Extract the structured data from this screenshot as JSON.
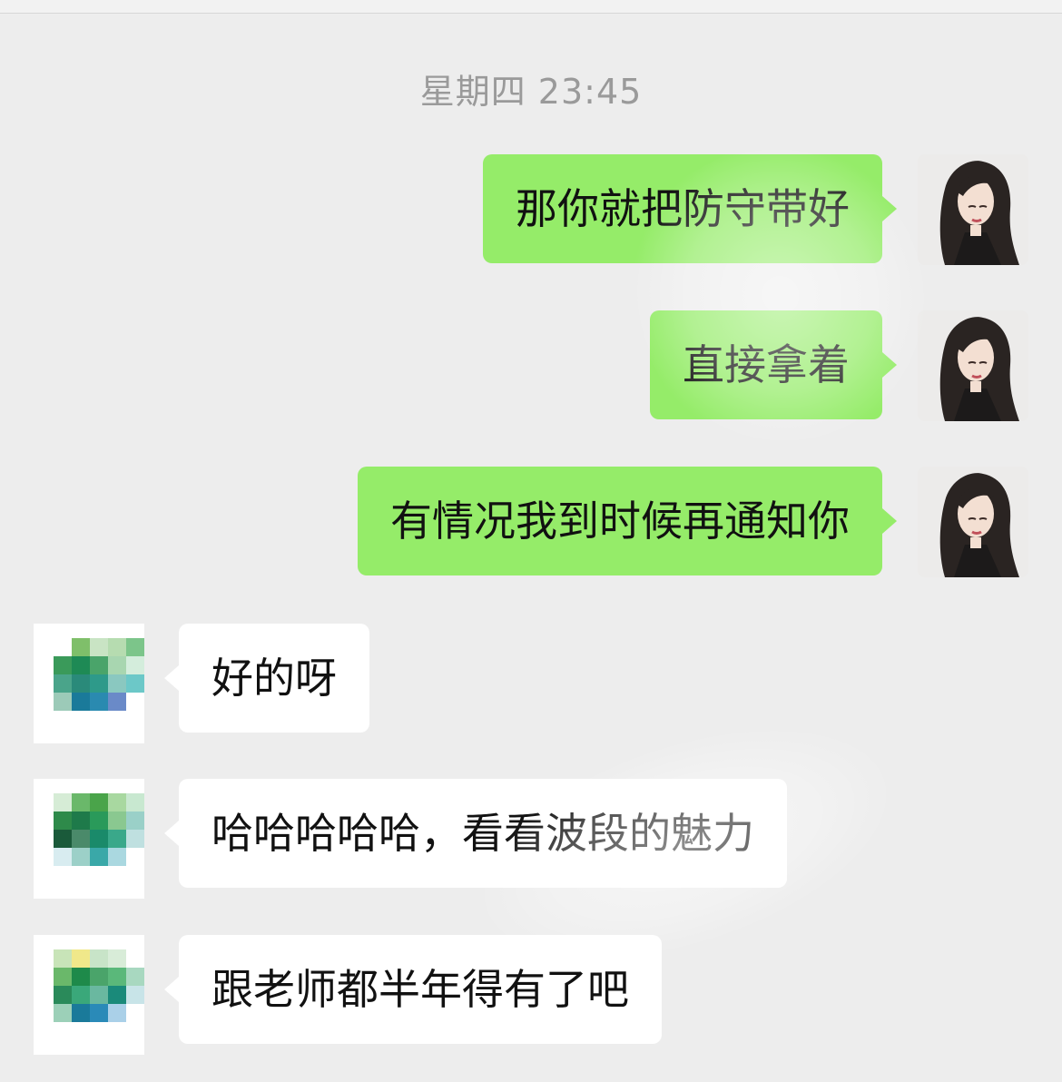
{
  "chat": {
    "timestamp": "星期四 23:45",
    "messages": [
      {
        "side": "out",
        "text": "那你就把防守带好"
      },
      {
        "side": "out",
        "text": "直接拿着"
      },
      {
        "side": "out",
        "text": "有情况我到时候再通知你"
      },
      {
        "side": "in",
        "text": "好的呀"
      },
      {
        "side": "in",
        "text": "哈哈哈哈哈，看看波段的魅力"
      },
      {
        "side": "in",
        "text": "跟老师都半年得有了吧"
      }
    ]
  },
  "colors": {
    "background": "#ededed",
    "outgoing_bubble": "#95ec69",
    "incoming_bubble": "#ffffff",
    "timestamp_text": "#9a9a9a"
  },
  "icons": {
    "outgoing_avatar": "girl-portrait-avatar",
    "incoming_avatar": "pixelated-avatar"
  }
}
